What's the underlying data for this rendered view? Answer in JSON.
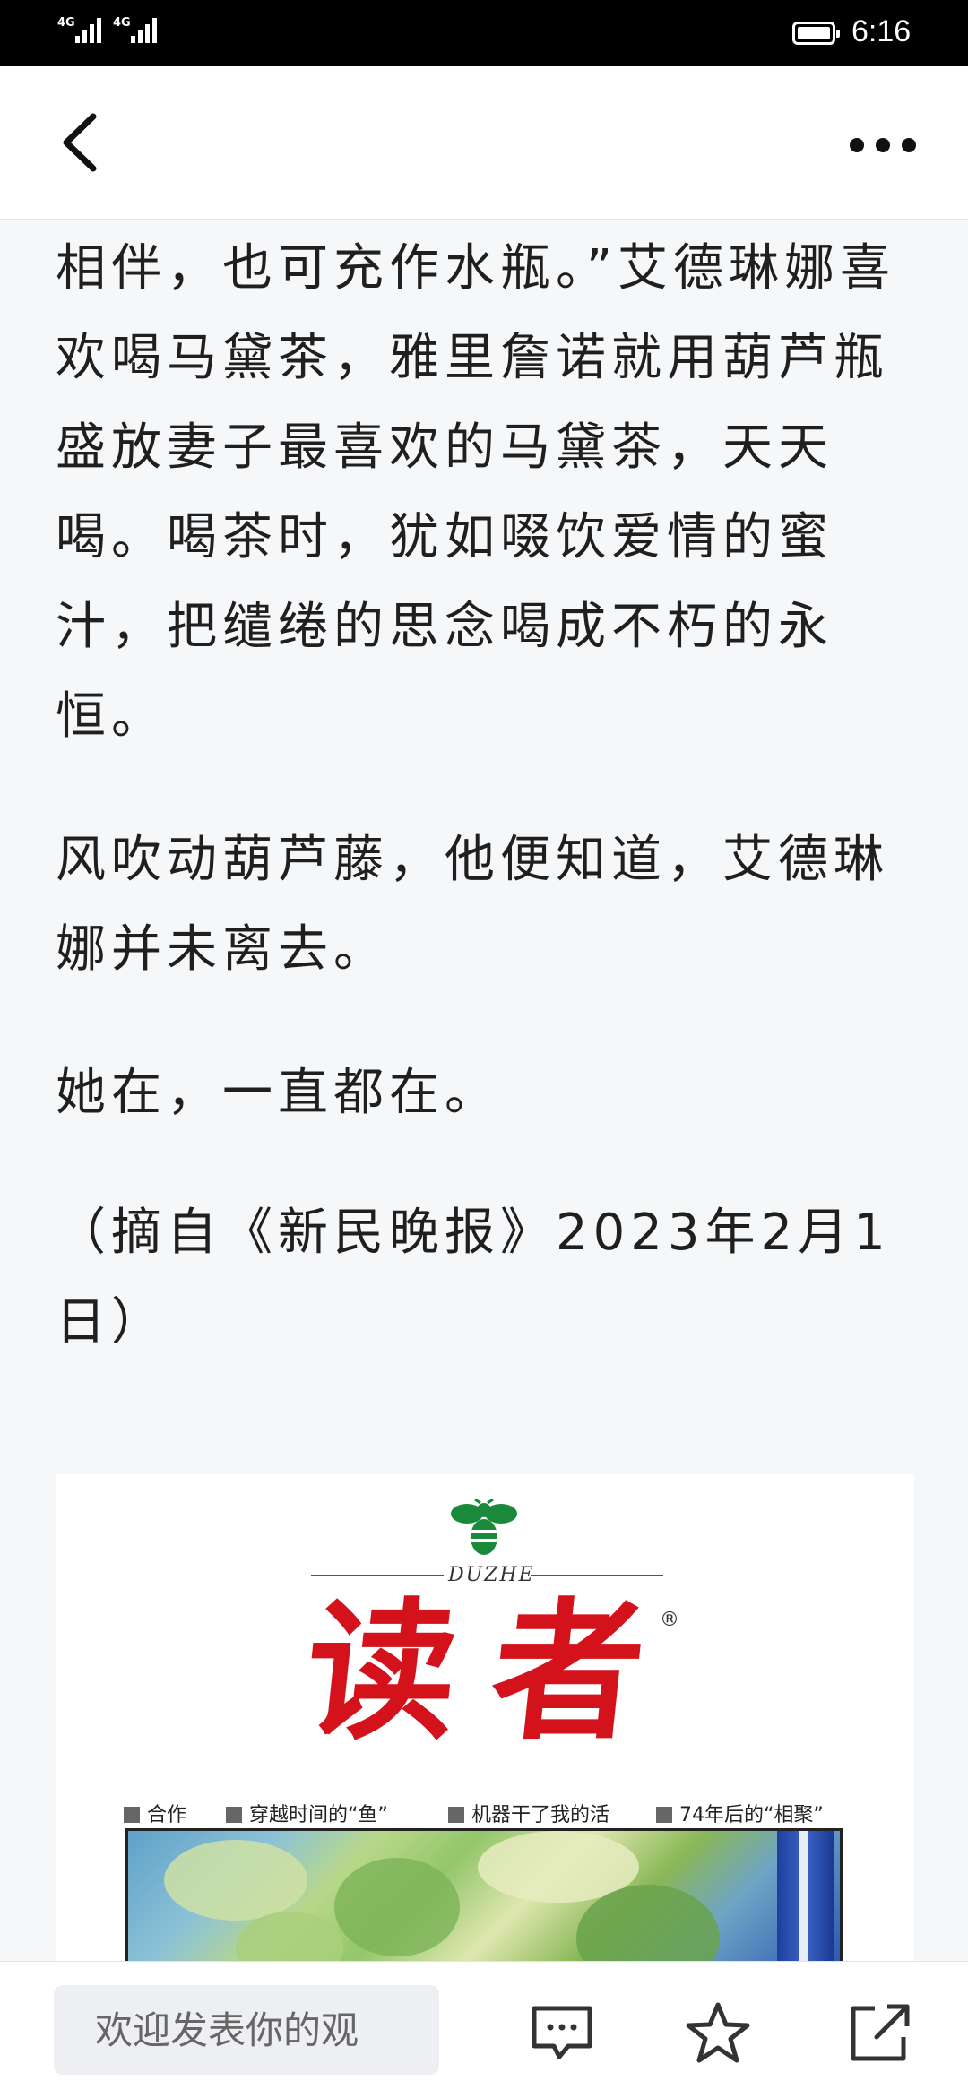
{
  "status_bar": {
    "signal_1": "4G",
    "signal_2": "4G",
    "time": "6:16",
    "battery_level": 1.0
  },
  "nav": {
    "back_icon": "chevron-left-icon",
    "more_icon": "more-horizontal-icon"
  },
  "article": {
    "paragraphs": [
      "相伴，也可充作水瓶。”艾德琳娜喜欢喝马黛茶，雅里詹诺就用葫芦瓶盛放妻子最喜欢的马黛茶，天天喝。喝茶时，犹如啜饮爱情的蜜汁，把缱绻的思念喝成不朽的永恒。",
      "风吹动葫芦藤，他便知道，艾德琳娜并未离去。",
      "她在，一直都在。",
      "（摘自《新民晚报》2023年2月1日）"
    ]
  },
  "magazine": {
    "brand_latin": "DUZHE",
    "brand_title": "读者",
    "registered_mark": "®",
    "headlines": [
      "合作",
      "穿越时间的“鱼”",
      "机器干了我的活",
      "74年后的“相聚”"
    ],
    "logo_color": "#d3121b",
    "bee_color": "#1a8a3a"
  },
  "bottom_bar": {
    "comment_placeholder": "欢迎发表你的观",
    "comment_icon": "comment-icon",
    "favorite_icon": "star-icon",
    "share_icon": "share-icon"
  }
}
